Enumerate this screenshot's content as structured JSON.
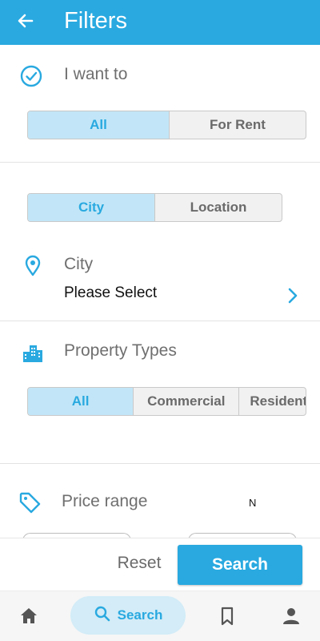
{
  "appbar": {
    "title": "Filters",
    "back_icon": "arrow-left-icon"
  },
  "want": {
    "label": "I want to",
    "icon": "check-circle-icon",
    "options": [
      "All",
      "For Rent"
    ],
    "selected": "All"
  },
  "location": {
    "options": [
      "City",
      "Location"
    ],
    "selected": "City",
    "city_label": "City",
    "city_value": "Please Select",
    "icon": "map-pin-icon"
  },
  "property": {
    "label": "Property Types",
    "icon": "buildings-icon",
    "options": [
      "All",
      "Commercial",
      "Residential"
    ],
    "selected": "All"
  },
  "price": {
    "label": "Price range",
    "icon": "tag-icon",
    "indicator": "N"
  },
  "actions": {
    "reset_label": "Reset",
    "search_label": "Search"
  },
  "bottom_nav": {
    "items": [
      {
        "icon": "home-icon"
      },
      {
        "icon": "search-icon",
        "label": "Search",
        "active": true
      },
      {
        "icon": "bookmark-icon"
      },
      {
        "icon": "profile-icon"
      }
    ]
  },
  "colors": {
    "primary": "#29a9e0",
    "selected_bg": "#c2e6f7",
    "unselected_bg": "#f1f1f1"
  }
}
